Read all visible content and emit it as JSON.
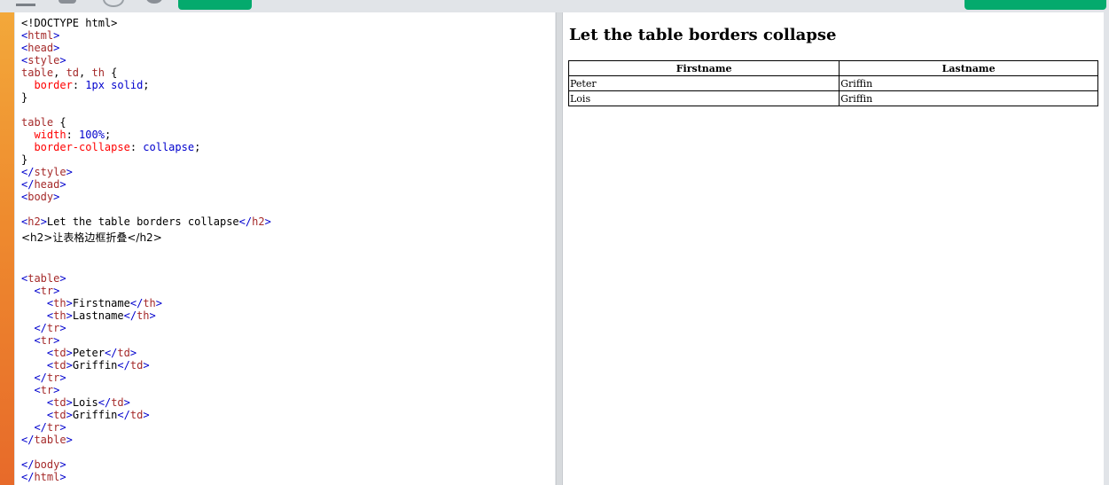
{
  "toolbar": {
    "run_label": "",
    "result_size_label": "",
    "get_site_label": ""
  },
  "code_lines": [
    {
      "t": "doctype",
      "text": "<!DOCTYPE html>"
    },
    {
      "t": "tag",
      "open": "<",
      "name": "html",
      "close": ">"
    },
    {
      "t": "tag",
      "open": "<",
      "name": "head",
      "close": ">"
    },
    {
      "t": "tag",
      "open": "<",
      "name": "style",
      "close": ">"
    },
    {
      "t": "selector",
      "text": "table, td, th {"
    },
    {
      "t": "decl",
      "prop": "border",
      "val": "1px solid"
    },
    {
      "t": "brace",
      "text": "}"
    },
    {
      "t": "blank"
    },
    {
      "t": "selector",
      "text": "table {"
    },
    {
      "t": "decl",
      "prop": "width",
      "val": "100%"
    },
    {
      "t": "decl",
      "prop": "border-collapse",
      "val": "collapse"
    },
    {
      "t": "brace",
      "text": "}"
    },
    {
      "t": "tag",
      "open": "</",
      "name": "style",
      "close": ">"
    },
    {
      "t": "tag",
      "open": "</",
      "name": "head",
      "close": ">"
    },
    {
      "t": "tag",
      "open": "<",
      "name": "body",
      "close": ">"
    },
    {
      "t": "blank"
    },
    {
      "t": "h2",
      "text": "Let the table borders collapse"
    },
    {
      "t": "plain",
      "text": "<h2>让表格边框折叠</h2>"
    },
    {
      "t": "blank"
    },
    {
      "t": "blank"
    },
    {
      "t": "tag",
      "open": "<",
      "name": "table",
      "close": ">"
    },
    {
      "t": "tag",
      "indent": "  ",
      "open": "<",
      "name": "tr",
      "close": ">"
    },
    {
      "t": "cell",
      "indent": "    ",
      "name": "th",
      "text": "Firstname"
    },
    {
      "t": "cell",
      "indent": "    ",
      "name": "th",
      "text": "Lastname"
    },
    {
      "t": "tag",
      "indent": "  ",
      "open": "</",
      "name": "tr",
      "close": ">"
    },
    {
      "t": "tag",
      "indent": "  ",
      "open": "<",
      "name": "tr",
      "close": ">"
    },
    {
      "t": "cell",
      "indent": "    ",
      "name": "td",
      "text": "Peter"
    },
    {
      "t": "cell",
      "indent": "    ",
      "name": "td",
      "text": "Griffin"
    },
    {
      "t": "tag",
      "indent": "  ",
      "open": "</",
      "name": "tr",
      "close": ">"
    },
    {
      "t": "tag",
      "indent": "  ",
      "open": "<",
      "name": "tr",
      "close": ">"
    },
    {
      "t": "cell",
      "indent": "    ",
      "name": "td",
      "text": "Lois"
    },
    {
      "t": "cell",
      "indent": "    ",
      "name": "td",
      "text": "Griffin"
    },
    {
      "t": "tag",
      "indent": "  ",
      "open": "</",
      "name": "tr",
      "close": ">"
    },
    {
      "t": "tag",
      "open": "</",
      "name": "table",
      "close": ">"
    },
    {
      "t": "blank"
    },
    {
      "t": "tag",
      "open": "</",
      "name": "body",
      "close": ">"
    },
    {
      "t": "tag",
      "open": "</",
      "name": "html",
      "close": ">"
    }
  ],
  "result": {
    "heading": "Let the table borders collapse",
    "headers": [
      "Firstname",
      "Lastname"
    ],
    "rows": [
      [
        "Peter",
        "Griffin"
      ],
      [
        "Lois",
        "Griffin"
      ]
    ]
  },
  "colors": {
    "tag": "#a52a2a",
    "bracket": "#0000cd",
    "property": "#ff0000",
    "value": "#0000cd",
    "accent_green": "#04aa6d"
  }
}
